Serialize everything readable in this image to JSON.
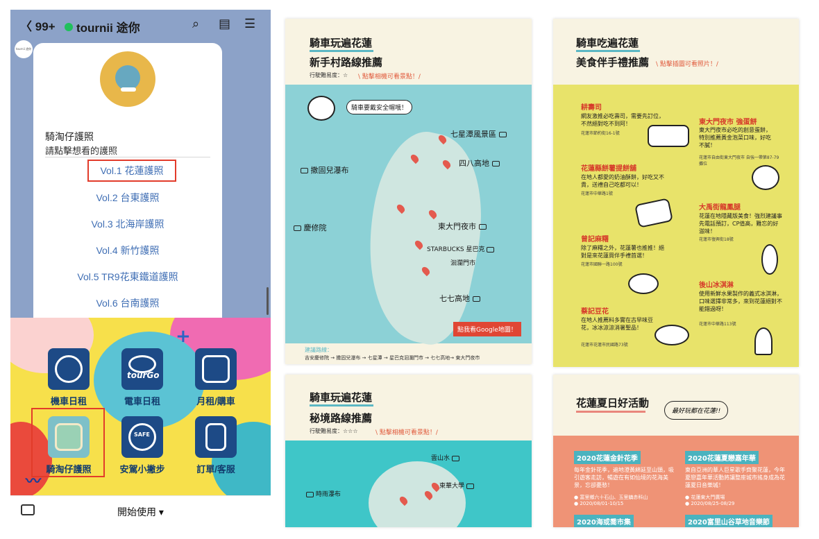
{
  "phone": {
    "back_count": "99+",
    "app_name": "tournii 途你",
    "avatar_text": "tournii 途你",
    "bubble_title": "騎淘仔護照",
    "bubble_subtitle": "請點擊想看的護照",
    "passports": [
      "Vol.1 花蓮護照",
      "Vol.2 台東護照",
      "Vol.3 北海岸護照",
      "Vol.4 新竹護照",
      "Vol.5 TR9花東鐵道護照",
      "Vol.6 台南護照"
    ],
    "menu": [
      {
        "label": "機車日租"
      },
      {
        "label": "電車日租",
        "brand": "tourGo"
      },
      {
        "label": "月租/購車"
      },
      {
        "label": "騎淘仔護照"
      },
      {
        "label": "安駕小撇步",
        "brand": "SAFE"
      },
      {
        "label": "訂單/客服"
      }
    ],
    "start_label": "開始使用 ▾"
  },
  "card1": {
    "title": "騎車玩遍花蓮",
    "subtitle": "新手村路線推薦",
    "difficulty": "行駛難易度：☆",
    "hint": "\\ 點擊相機可看景點！/",
    "speech": "騎車要戴安全帽哦！",
    "labels": [
      "七星潭風景區",
      "四八高地",
      "撒固兒瀑布",
      "慶修院",
      "東大門夜市",
      "STARBUCKS 星巴克",
      "洄瀾門市",
      "七七高地"
    ],
    "google_btn": "點我看Google地圖！",
    "route_label": "建議路線：",
    "route": "吉安慶修院 → 撒固兒瀑布 → 七星潭 → 星巴克洄瀾門市 → 七七高地→ 東大門夜市"
  },
  "card2": {
    "title": "騎車玩遍花蓮",
    "subtitle": "秘境路線推薦",
    "difficulty": "行駛難易度：☆☆☆",
    "hint": "\\ 點擊相機可看景點！/",
    "labels": [
      "雲山水",
      "時雨瀑布",
      "東華大學"
    ]
  },
  "card3": {
    "title": "騎車吃遍花蓮",
    "subtitle": "美食伴手禮推薦",
    "hint": "\\ 點擊插圖可看照片！/",
    "items": [
      {
        "name": "耕壽司",
        "desc": "網友激推必吃壽司，需要先訂位，不然絕對吃不到阿！",
        "addr": "花蓮市節約街16-1號"
      },
      {
        "name": "東大門夜市 強蛋餅",
        "desc": "東大門夜市必吃的創意蛋餅，特別推薦黃金泡菜口味，好吃不膩！",
        "addr": "花蓮市自由街東大門夜市 自強一帶第87-79攤位"
      },
      {
        "name": "花蓮縣餅薯提餅舖",
        "desc": "在地人都愛的奶油酥餅，好吃又不貴，送禮自己吃都可以！",
        "addr": "花蓮市中華路1號"
      },
      {
        "name": "大禹街龍鳳腿",
        "desc": "花蓮在地隱藏版美食！強烈建議事先電話預訂，CP值高，難忘的好滋味！",
        "addr": "花蓮市復興街18號"
      },
      {
        "name": "曾記麻糬",
        "desc": "除了麻糬之外，花蓮薯也推推！絕對是來花蓮買伴手禮首選！",
        "addr": "花蓮市國聯一路100號"
      },
      {
        "name": "後山冰淇淋",
        "desc": "使用新鮮水果製作的義式冰淇淋，口味選擇非常多，來到花蓮絕對不能錯過呀！",
        "addr": "花蓮市中華路113號"
      },
      {
        "name": "蔡記豆花",
        "desc": "在地人推薦料多實在古早味豆花，冰冰涼涼消暑聖品！",
        "addr": "花蓮市花蓮市民國路73號"
      }
    ]
  },
  "card4": {
    "title": "花蓮夏日好活動",
    "sign": "最好玩都在花蓮!!",
    "events": [
      {
        "name": "2020花蓮金針花季",
        "desc": "每年金針花季，遍地澄黃綿延至山頭，吸引遊客走訪，暢遊在有如仙境的花海美景，忘卻憂愁！",
        "place": "富里鄉六十石山、玉里鎮赤科山",
        "date": "2020/08/01-10/15"
      },
      {
        "name": "2020花蓮夏戀嘉年華",
        "desc": "東自亞洲的華人巨星歌手齊聚花蓮，今年夏戀嘉年華活動將讓整座城市搖身成為花蓮夏日音樂城！",
        "place": "花蓮東大門廣場",
        "date": "2020/08/25-08/29"
      },
      {
        "name": "2020海或喬市集",
        "desc": ""
      },
      {
        "name": "2020富里山谷草地音樂節",
        "desc": ""
      }
    ]
  }
}
